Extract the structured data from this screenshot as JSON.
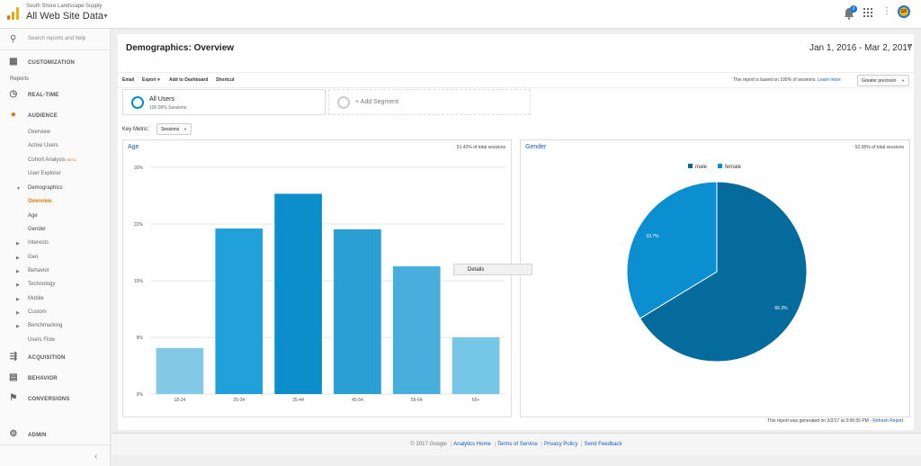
{
  "header": {
    "account": "South Shore Landscape Supply",
    "property": "All Web Site Data",
    "notifications": "2",
    "avatar": "GF"
  },
  "sidebar": {
    "search_placeholder": "Search reports and help",
    "customization": "CUSTOMIZATION",
    "reports_label": "Reports",
    "realtime": "REAL-TIME",
    "audience": "AUDIENCE",
    "audience_items": {
      "overview": "Overview",
      "active_users": "Active Users",
      "cohort": "Cohort Analysis",
      "cohort_badge": "BETA",
      "user_explorer": "User Explorer",
      "demographics": "Demographics",
      "demo_overview": "Overview",
      "demo_age": "Age",
      "demo_gender": "Gender",
      "interests": "Interests",
      "geo": "Geo",
      "behavior": "Behavior",
      "technology": "Technology",
      "mobile": "Mobile",
      "custom": "Custom",
      "benchmarking": "Benchmarking",
      "users_flow": "Users Flow"
    },
    "acquisition": "ACQUISITION",
    "behavior": "BEHAVIOR",
    "conversions": "CONVERSIONS",
    "admin": "ADMIN"
  },
  "main": {
    "title": "Demographics: Overview",
    "date_range": "Jan 1, 2016 - Mar 2, 2017",
    "toolbar": {
      "email": "Email",
      "export": "Export",
      "add_dashboard": "Add to Dashboard",
      "shortcut": "Shortcut",
      "note": "This report is based on 100% of sessions.",
      "learn_more": "Learn more",
      "precision": "Greater precision"
    },
    "segments": {
      "all_users": "All Users",
      "all_users_sub": "100.00% Sessions",
      "add_segment": "+ Add Segment"
    },
    "key_metric_label": "Key Metric:",
    "key_metric_value": "Sessions",
    "age_panel": {
      "title": "Age",
      "share": "51.42% of total sessions"
    },
    "gender_panel": {
      "title": "Gender",
      "share": "52.95% of total sessions"
    },
    "tooltip": "Details",
    "generated": "This report was generated on 3/2/17 at 3:06:55 PM -",
    "refresh": "Refresh Report"
  },
  "footer": {
    "copyright": "© 2017 Google",
    "links": [
      "Analytics Home",
      "Terms of Service",
      "Privacy Policy",
      "Send Feedback"
    ]
  },
  "colors": {
    "accent_orange": "#e37400",
    "link_blue": "#1a5ab4",
    "male": "#056a9c",
    "female": "#0b8fd0"
  },
  "chart_data": [
    {
      "type": "bar",
      "title": "Age",
      "categories": [
        "18-24",
        "25-34",
        "35-44",
        "45-54",
        "55-64",
        "65+"
      ],
      "values": [
        6.1,
        21.9,
        26.5,
        21.8,
        16.9,
        7.5
      ],
      "colors": [
        "#84c8e8",
        "#21a1d9",
        "#0b8ec9",
        "#2a9fd4",
        "#47aede",
        "#76c6e8"
      ],
      "yticks": [
        "0%",
        "8%",
        "15%",
        "22%",
        "30%"
      ],
      "ylim": [
        0,
        30
      ],
      "unit": "%"
    },
    {
      "type": "pie",
      "title": "Gender",
      "labels": [
        "male",
        "female"
      ],
      "values": [
        66.3,
        33.7
      ],
      "value_labels": [
        "66.3%",
        "33.7%"
      ],
      "colors": [
        "#056a9c",
        "#0b8fd0"
      ],
      "legend": "top"
    }
  ]
}
